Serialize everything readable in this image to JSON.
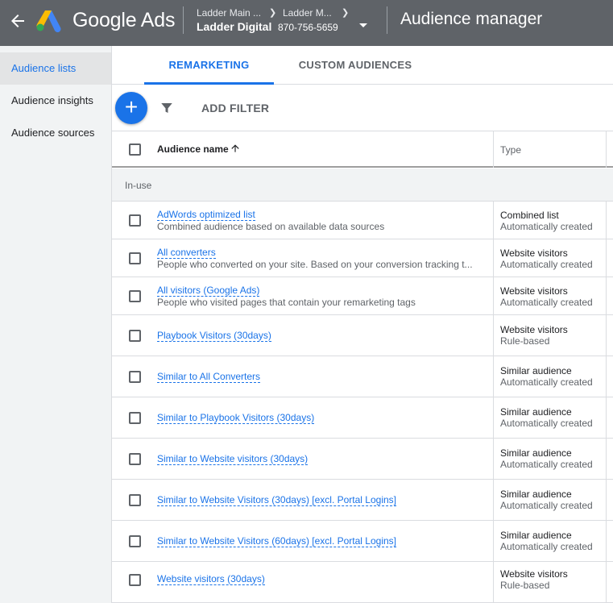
{
  "header": {
    "brand": "Google Ads",
    "breadcrumb": [
      "Ladder Main ...",
      "Ladder M..."
    ],
    "account_name": "Ladder Digital",
    "account_id": "870-756-5659",
    "page_title": "Audience manager"
  },
  "sidebar": {
    "items": [
      {
        "label": "Audience lists",
        "active": true
      },
      {
        "label": "Audience insights",
        "active": false
      },
      {
        "label": "Audience sources",
        "active": false
      }
    ]
  },
  "tabs": [
    {
      "label": "REMARKETING",
      "active": true
    },
    {
      "label": "CUSTOM AUDIENCES",
      "active": false
    }
  ],
  "toolbar": {
    "add_label": "+",
    "filter_label": "ADD FILTER"
  },
  "table": {
    "columns": {
      "name": "Audience name",
      "type": "Type"
    },
    "section": "In-use",
    "rows": [
      {
        "name": "AdWords optimized list",
        "desc": "Combined audience based on available data sources",
        "type": "Combined list",
        "sub": "Automatically created"
      },
      {
        "name": "All converters",
        "desc": "People who converted on your site. Based on your conversion tracking t...",
        "type": "Website visitors",
        "sub": "Automatically created"
      },
      {
        "name": "All visitors (Google Ads)",
        "desc": "People who visited pages that contain your remarketing tags",
        "type": "Website visitors",
        "sub": "Automatically created"
      },
      {
        "name": "Playbook Visitors (30days)",
        "desc": "",
        "type": "Website visitors",
        "sub": "Rule-based"
      },
      {
        "name": "Similar to All Converters",
        "desc": "",
        "type": "Similar audience",
        "sub": "Automatically created"
      },
      {
        "name": "Similar to Playbook Visitors (30days)",
        "desc": "",
        "type": "Similar audience",
        "sub": "Automatically created"
      },
      {
        "name": "Similar to Website visitors (30days)",
        "desc": "",
        "type": "Similar audience",
        "sub": "Automatically created"
      },
      {
        "name": "Similar to Website Visitors (30days) [excl. Portal Logins]",
        "desc": "",
        "type": "Similar audience",
        "sub": "Automatically created"
      },
      {
        "name": "Similar to Website Visitors (60days) [excl. Portal Logins]",
        "desc": "",
        "type": "Similar audience",
        "sub": "Automatically created"
      },
      {
        "name": "Website visitors (30days)",
        "desc": "",
        "type": "Website visitors",
        "sub": "Rule-based"
      }
    ]
  },
  "colors": {
    "header_bg": "#5f6368",
    "accent": "#1a73e8",
    "sidebar_bg": "#f1f3f4"
  }
}
